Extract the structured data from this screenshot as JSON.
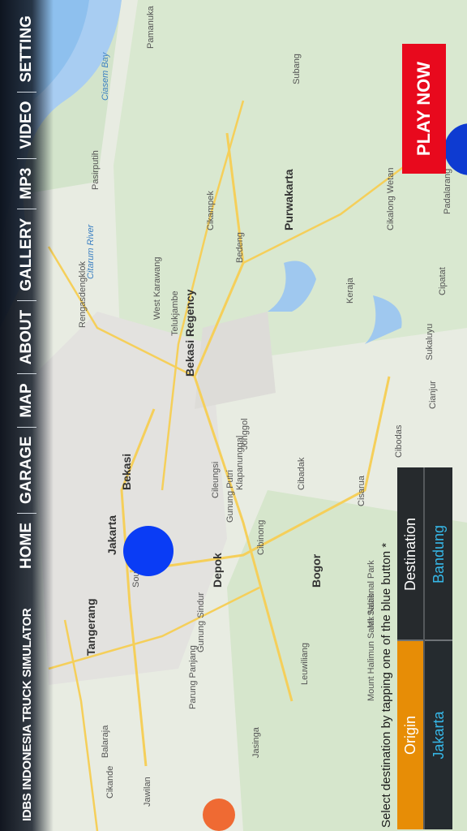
{
  "app": {
    "title": "IDBS INDONESIA TRUCK SIMULATOR"
  },
  "nav": {
    "items": [
      "HOME",
      "GARAGE",
      "MAP",
      "ABOUT",
      "GALLERY",
      "MP3",
      "VIDEO",
      "SETTING"
    ]
  },
  "play_button": {
    "label": "PLAY NOW"
  },
  "instruction": "Select destination by tapping one of the blue button *",
  "selection": {
    "origin_label": "Origin",
    "origin_value": "Jakarta",
    "destination_label": "Destination",
    "destination_value": "Bandung"
  },
  "map_labels": {
    "tangerang": "Tangerang",
    "jakarta": "Jakarta",
    "bekasi": "Bekasi",
    "bekasi_regency": "Bekasi Regency",
    "depok": "Depok",
    "bogor": "Bogor",
    "purwakarta": "Purwakarta",
    "subang": "Subang",
    "pamanukan": "Pamanuka",
    "south": "South",
    "cikampek": "Cikampek",
    "karawang": "West Karawang",
    "telukjambe": "Telukjambe",
    "rengasdengklok": "Rengasdengklok",
    "citarum": "Citarum River",
    "ciasem": "Ciasem Bay",
    "pasirputih": "Pasirputih",
    "jonggol": "Jonggol",
    "klapanunggal": "Klapanunggal",
    "cileungsi": "Cileungsi",
    "gunung_putri": "Gunung Putri",
    "cibinong": "Cibinong",
    "cibadak": "Cibadak",
    "cisarua": "Cisarua",
    "cibodas": "Cibodas",
    "cianjur": "Cianjur",
    "sukaluyu": "Sukaluyu",
    "cipatat": "Cipatat",
    "padalarang": "Padalarang",
    "cikalong": "Cikalong Wetan",
    "kerja": "Keraja",
    "bedeng": "Bedeng",
    "leuwiliang": "Leuwiliang",
    "jasinga": "Jasinga",
    "mt_salak": "Mt Salak",
    "gunung_sindur": "Gunung Sindur",
    "parung_panjang": "Parung Panjang",
    "balaraja": "Balaraja",
    "cikande": "Cikande",
    "jawilan": "Jawilan",
    "halimun": "Mount Halimun Salak National Park"
  },
  "colors": {
    "nav_bg": "#0f1620",
    "play_button": "#e8091d",
    "origin_header": "#e78d06",
    "panel_bg": "#262a2d",
    "value_text": "#36b8e8",
    "blue_button": "#0a3cf5"
  },
  "icons": [
    "fab-icon"
  ]
}
